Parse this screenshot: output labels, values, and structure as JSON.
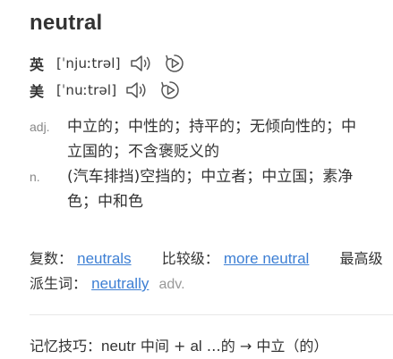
{
  "headword": "neutral",
  "pronunciations": [
    {
      "region": "英",
      "phonetic": "[ˈnjuːtrəl]",
      "speaker_icon": "speaker-icon",
      "replay_icon": "replay-icon"
    },
    {
      "region": "美",
      "phonetic": "[ˈnuːtrəl]",
      "speaker_icon": "speaker-icon",
      "replay_icon": "replay-icon"
    }
  ],
  "definitions": [
    {
      "pos": "adj.",
      "text": "中立的；中性的；持平的；无倾向性的；中立国的；不含褒贬义的"
    },
    {
      "pos": "n.",
      "text": "(汽车排挡)空挡的；中立者；中立国；素净色；中和色"
    }
  ],
  "word_forms": {
    "plural_label": "复数：",
    "plural_value": "neutrals",
    "comparative_label": "比较级：",
    "comparative_value": "more neutral",
    "superlative_label": "最高级",
    "derived_label": "派生词：",
    "derived_value": "neutrally",
    "derived_pos": "adv."
  },
  "mnemonic": {
    "label": "记忆技巧：",
    "text_en": "neutr",
    "text_middle": " 中间 + ",
    "text_en2": "al",
    "text_end": " …的 → 中立（的）"
  },
  "colors": {
    "link": "#3d7fd4",
    "text": "#333333",
    "muted": "#888888",
    "icon": "#555555"
  }
}
